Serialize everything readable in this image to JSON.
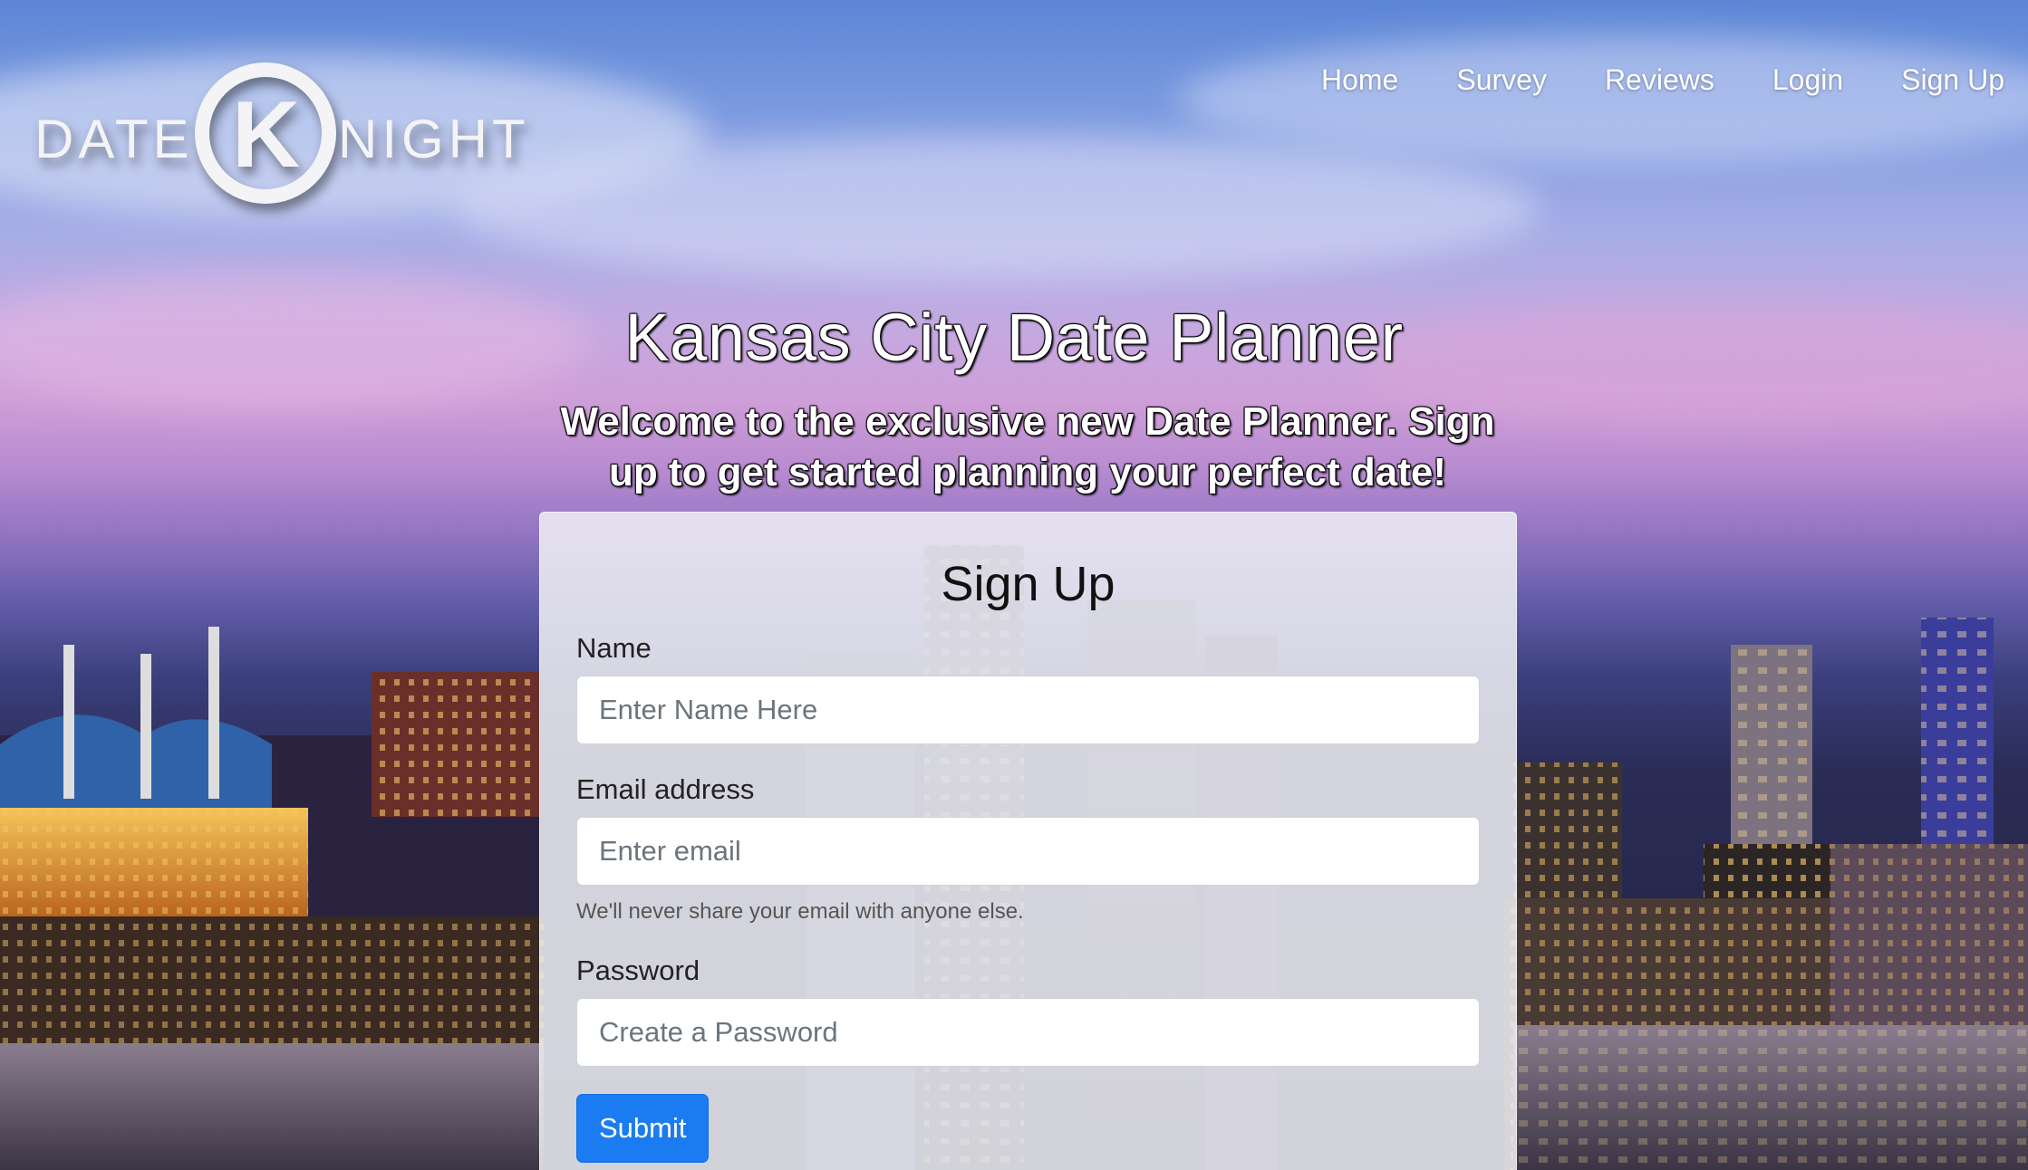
{
  "brand": {
    "logo_text_left": "DATE",
    "logo_letter": "K",
    "logo_text_right": "NIGHT"
  },
  "nav": {
    "items": [
      {
        "label": "Home"
      },
      {
        "label": "Survey"
      },
      {
        "label": "Reviews"
      },
      {
        "label": "Login"
      },
      {
        "label": "Sign Up"
      }
    ]
  },
  "hero": {
    "title": "Kansas City Date Planner",
    "subtitle": "Welcome to the exclusive new Date Planner. Sign up to get started planning your perfect date!"
  },
  "form": {
    "title": "Sign Up",
    "name_label": "Name",
    "name_placeholder": "Enter Name Here",
    "email_label": "Email address",
    "email_placeholder": "Enter email",
    "email_help": "We'll never share your email with anyone else.",
    "password_label": "Password",
    "password_placeholder": "Create a Password",
    "submit_label": "Submit"
  },
  "colors": {
    "primary": "#1a7cf0",
    "text_white": "#ffffff"
  }
}
